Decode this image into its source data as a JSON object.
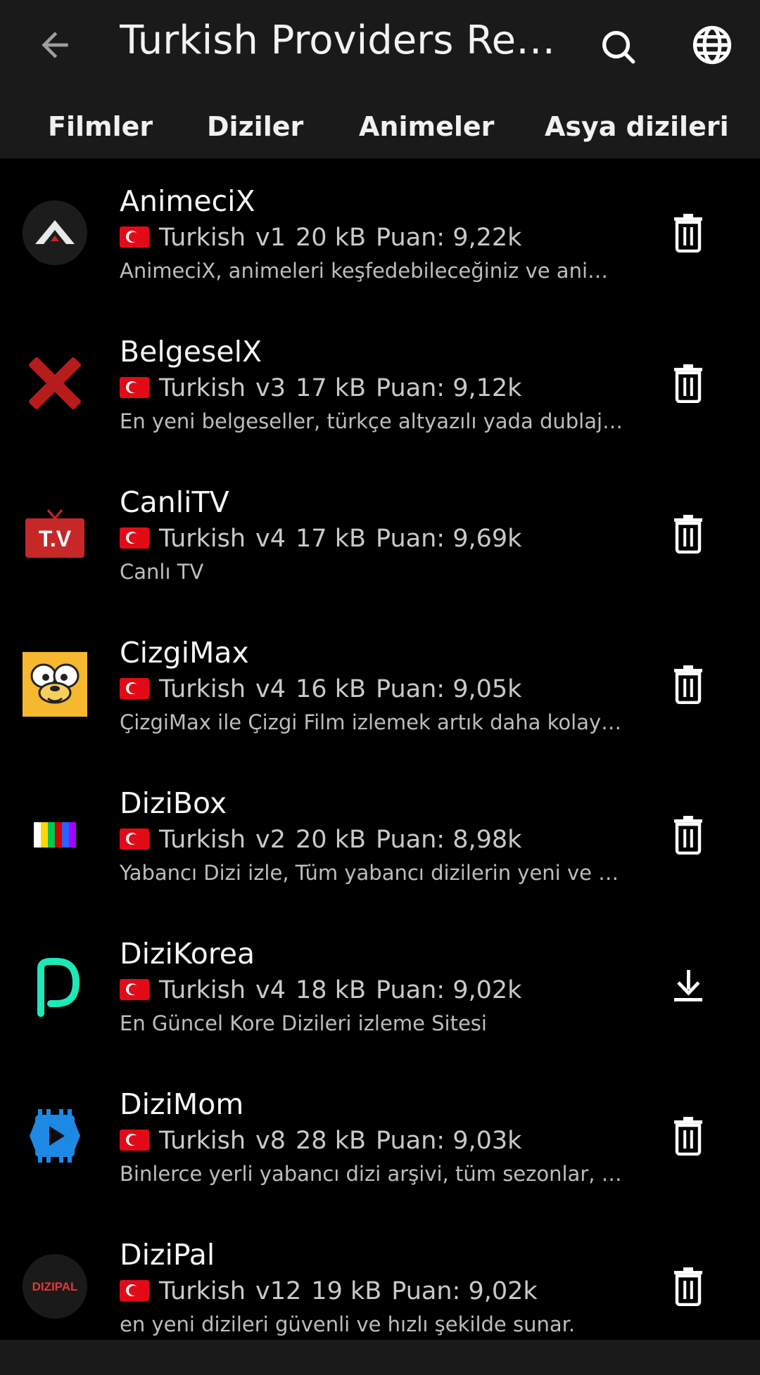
{
  "header": {
    "title": "Turkish Providers Rep...",
    "back_icon": "arrow-left-icon",
    "search_icon": "search-icon",
    "language_icon": "globe-icon"
  },
  "tabs": [
    {
      "label": "Filmler"
    },
    {
      "label": "Diziler"
    },
    {
      "label": "Animeler"
    },
    {
      "label": "Asya dizileri"
    }
  ],
  "colors": {
    "background": "#000000",
    "topbar": "#1a1a1a",
    "text_primary": "#f5f5f5",
    "text_secondary": "#c9c9c9"
  },
  "plugins": [
    {
      "name": "AnimeciX",
      "language": "Turkish",
      "version": "v1",
      "size": "20 kB",
      "rating": "Puan: 9,22k",
      "description": "AnimeciX, animeleri keşfedebileceğiniz ve anim...",
      "action_icon": "trash-icon"
    },
    {
      "name": "BelgeselX",
      "language": "Turkish",
      "version": "v3",
      "size": "17 kB",
      "rating": "Puan: 9,12k",
      "description": "En yeni belgeseller, türkçe altyazılı yada dublaj o...",
      "action_icon": "trash-icon"
    },
    {
      "name": "CanliTV",
      "language": "Turkish",
      "version": "v4",
      "size": "17 kB",
      "rating": "Puan: 9,69k",
      "description": "Canlı TV",
      "action_icon": "trash-icon",
      "logo_text": "T.V"
    },
    {
      "name": "CizgiMax",
      "language": "Turkish",
      "version": "v4",
      "size": "16 kB",
      "rating": "Puan: 9,05k",
      "description": "ÇizgiMax ile Çizgi Film izlemek artık daha kolay,...",
      "action_icon": "trash-icon"
    },
    {
      "name": "DiziBox",
      "language": "Turkish",
      "version": "v2",
      "size": "20 kB",
      "rating": "Puan: 8,98k",
      "description": "Yabancı Dizi izle, Tüm yabancı dizilerin yeni ve e...",
      "action_icon": "trash-icon"
    },
    {
      "name": "DiziKorea",
      "language": "Turkish",
      "version": "v4",
      "size": "18 kB",
      "rating": "Puan: 9,02k",
      "description": "En Güncel Kore Dizileri izleme Sitesi",
      "action_icon": "download-icon"
    },
    {
      "name": "DiziMom",
      "language": "Turkish",
      "version": "v8",
      "size": "28 kB",
      "rating": "Puan: 9,03k",
      "description": "Binlerce yerli yabancı dizi arşivi, tüm sezonlar, k...",
      "action_icon": "trash-icon"
    },
    {
      "name": "DiziPal",
      "language": "Turkish",
      "version": "v12",
      "size": "19 kB",
      "rating": "Puan: 9,02k",
      "description": "en yeni dizileri güvenli ve hızlı şekilde sunar.",
      "action_icon": "trash-icon",
      "logo_text": "DIZIPAL"
    }
  ]
}
